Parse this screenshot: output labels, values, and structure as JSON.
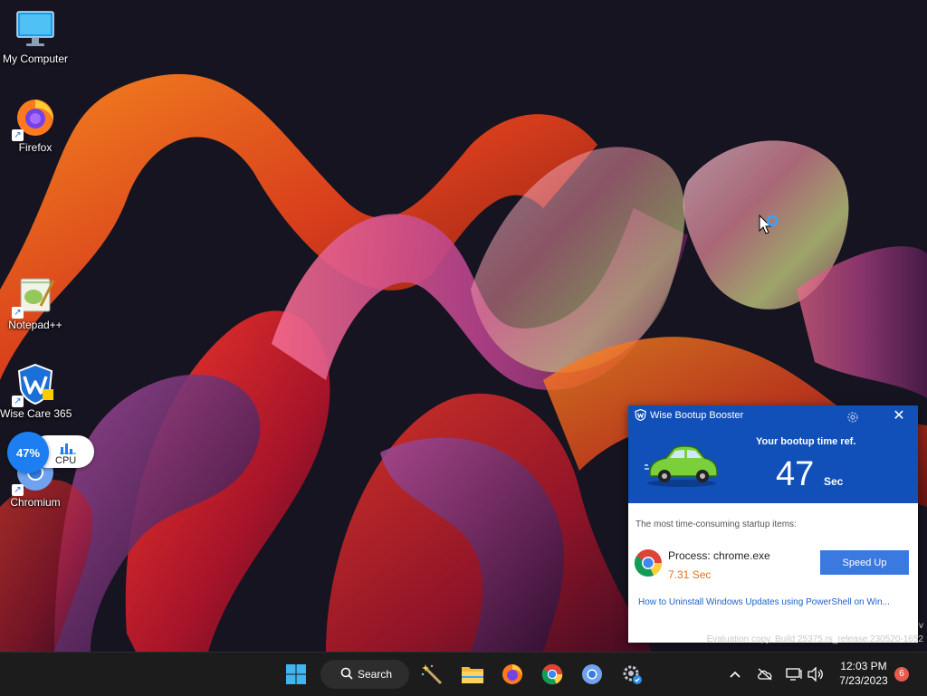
{
  "desktop": {
    "icons": [
      {
        "label": "My Computer"
      },
      {
        "label": "Firefox"
      },
      {
        "label": "Notepad++"
      },
      {
        "label": "Wise Care 365"
      },
      {
        "label": "Chromium"
      }
    ]
  },
  "cpu_widget": {
    "percent": "47%",
    "label": "CPU"
  },
  "popup": {
    "title": "Wise Bootup Booster",
    "boot_title": "Your bootup time ref.",
    "seconds": "47",
    "seconds_unit": "Sec",
    "subtitle": "The most time-consuming startup items:",
    "process_label": "Process: chrome.exe",
    "process_time": "7.31 Sec",
    "speed_up_label": "Speed Up",
    "link_text": "How to Uninstall Windows Updates using PowerShell on Win..."
  },
  "watermark": {
    "line1": "v",
    "line2": "Evaluation copy. Build 25375.rs_release.230520-1652"
  },
  "taskbar": {
    "search_label": "Search",
    "icons": [
      "start-icon",
      "search-icon",
      "wand-icon",
      "file-explorer-icon",
      "firefox-icon",
      "chrome-icon",
      "chromium-icon",
      "settings-icon"
    ]
  },
  "tray": {
    "time": "12:03 PM",
    "date": "7/23/2023",
    "notification_count": "6"
  }
}
